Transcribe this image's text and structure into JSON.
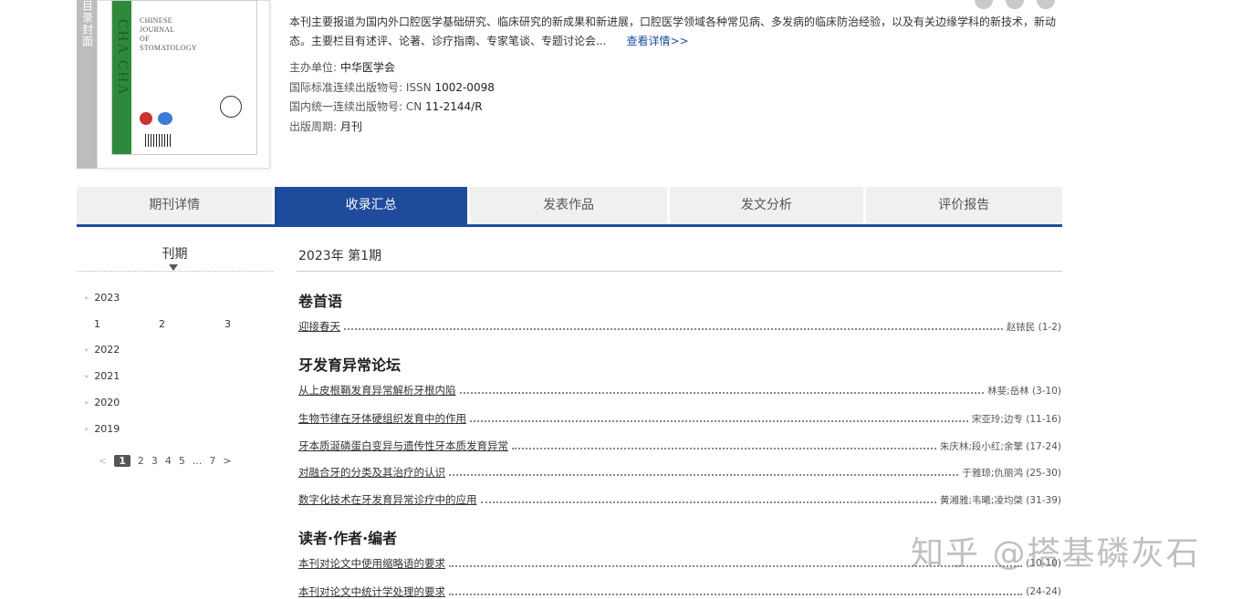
{
  "cover": {
    "side_label": "目录封面",
    "band_text": "CHA CHA",
    "title_lines": "CHINESE\nJOURNAL\nOF\nSTOMATOLOGY"
  },
  "journal": {
    "description": "本刊主要报道为国内外口腔医学基础研究、临床研究的新成果和新进展，口腔医学领域各种常见病、多发病的临床防治经验，以及有关边缘学科的新技术，新动态。主要栏目有述评、论著、诊疗指南、专家笔谈、专题讨论会...",
    "more_link": "查看详情>>",
    "meta": [
      {
        "label": "主办单位: ",
        "value": "中华医学会"
      },
      {
        "label": "国际标准连续出版物号: ISSN ",
        "value": "1002-0098"
      },
      {
        "label": "国内统一连续出版物号: CN ",
        "value": "11-2144/R"
      },
      {
        "label": "出版周期: ",
        "value": "月刊"
      }
    ]
  },
  "tabs": [
    "期刊详情",
    "收录汇总",
    "发表作品",
    "发文分析",
    "评价报告"
  ],
  "active_tab": 1,
  "sidebar": {
    "title": "刊期",
    "years": [
      "2023",
      "2022",
      "2021",
      "2020",
      "2019"
    ],
    "issues_2023": [
      "1",
      "2",
      "3"
    ],
    "pager": {
      "prev": "<",
      "pages": [
        "1",
        "2",
        "3",
        "4",
        "5",
        "...",
        "7"
      ],
      "next": ">",
      "current": "1"
    }
  },
  "current_issue": "2023年 第1期",
  "sections": [
    {
      "heading": "卷首语",
      "articles": [
        {
          "title": "迎接春天",
          "authors": "赵铱民 (1-2)"
        }
      ]
    },
    {
      "heading": "牙发育异常论坛",
      "articles": [
        {
          "title": "从上皮根鞘发育异常解析牙根内陷",
          "authors": "林斐;岳林 (3-10)"
        },
        {
          "title": "生物节律在牙体硬组织发育中的作用",
          "authors": "宋亚玲;边专 (11-16)"
        },
        {
          "title": "牙本质涎磷蛋白变异与遗传性牙本质发育异常",
          "authors": "朱庆林;段小红;余擎 (17-24)"
        },
        {
          "title": "对融合牙的分类及其治疗的认识",
          "authors": "于雅琼;仇丽鸿 (25-30)"
        },
        {
          "title": "数字化技术在牙发育异常诊疗中的应用",
          "authors": "黄湘雅;韦曦;凌均棨 (31-39)"
        }
      ]
    },
    {
      "heading": "读者·作者·编者",
      "articles": [
        {
          "title": "本刊对论文中使用缩略语的要求",
          "authors": "(10-10)"
        },
        {
          "title": "本刊对论文中统计学处理的要求",
          "authors": "(24-24)"
        }
      ]
    }
  ],
  "watermark": "知乎 @搭基磷灰石",
  "colors": {
    "accent": "#1e4b9b",
    "link": "#1a4fa0"
  }
}
